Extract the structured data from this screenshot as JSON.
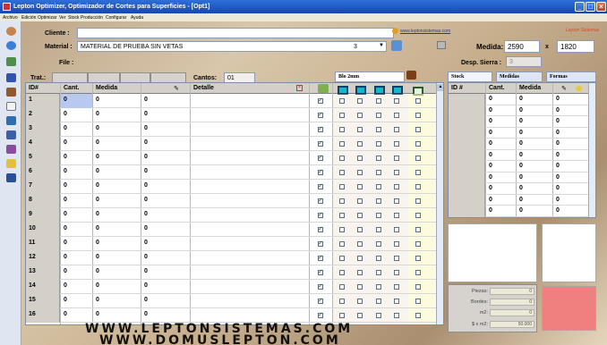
{
  "window": {
    "title": "Lepton Optimizer, Optimizador de Cortes para Superficies - [Opt1]",
    "controls": {
      "minimize": "_",
      "restore": "□",
      "close": "×"
    }
  },
  "menu": [
    "Archivo",
    "Edición",
    "Optimizar",
    "Ver",
    "Stock",
    "Producción",
    "Configurar",
    "Ayuda"
  ],
  "header": {
    "cliente_label": "Cliente :",
    "cliente_value": "",
    "material_label": "Material :",
    "material_value": "MATERIAL DE PRUEBA SIN VETAS",
    "material_qty": "3",
    "file_label": "File :",
    "file_value": "",
    "link": "www.leptonsistemas.com",
    "brand": "Lepton Sistemas",
    "medida_label": "Medida:",
    "medida_w": "2590",
    "medida_x": "x",
    "medida_h": "1820",
    "desp_label": "Desp. Sierra :",
    "desp_value": "3"
  },
  "toolbar2": {
    "trat_label": "Trat.:",
    "cantos_label": "Cantos:",
    "cantos_value": "01",
    "canto_name": "Blo 2mm"
  },
  "grid": {
    "headers": {
      "id": "ID#",
      "cant": "Cant.",
      "medida": "Medida",
      "detalle": "Detalle"
    },
    "rows": [
      {
        "id": "1",
        "cant": "0",
        "m1": "0",
        "m2": "0",
        "checked": true
      },
      {
        "id": "2",
        "cant": "0",
        "m1": "0",
        "m2": "0",
        "checked": true
      },
      {
        "id": "3",
        "cant": "0",
        "m1": "0",
        "m2": "0",
        "checked": true
      },
      {
        "id": "4",
        "cant": "0",
        "m1": "0",
        "m2": "0",
        "checked": true
      },
      {
        "id": "5",
        "cant": "0",
        "m1": "0",
        "m2": "0",
        "checked": true
      },
      {
        "id": "6",
        "cant": "0",
        "m1": "0",
        "m2": "0",
        "checked": true
      },
      {
        "id": "7",
        "cant": "0",
        "m1": "0",
        "m2": "0",
        "checked": true
      },
      {
        "id": "8",
        "cant": "0",
        "m1": "0",
        "m2": "0",
        "checked": true
      },
      {
        "id": "9",
        "cant": "0",
        "m1": "0",
        "m2": "0",
        "checked": true
      },
      {
        "id": "10",
        "cant": "0",
        "m1": "0",
        "m2": "0",
        "checked": true
      },
      {
        "id": "11",
        "cant": "0",
        "m1": "0",
        "m2": "0",
        "checked": true
      },
      {
        "id": "12",
        "cant": "0",
        "m1": "0",
        "m2": "0",
        "checked": true
      },
      {
        "id": "13",
        "cant": "0",
        "m1": "0",
        "m2": "0",
        "checked": true
      },
      {
        "id": "14",
        "cant": "0",
        "m1": "0",
        "m2": "0",
        "checked": true
      },
      {
        "id": "15",
        "cant": "0",
        "m1": "0",
        "m2": "0",
        "checked": true
      },
      {
        "id": "16",
        "cant": "0",
        "m1": "0",
        "m2": "0",
        "checked": true
      }
    ]
  },
  "stock": {
    "tabs": [
      "Stock",
      "Medidas",
      "Formas"
    ],
    "headers": {
      "id": "ID #",
      "cant": "Cant.",
      "medida": "Medida"
    },
    "rows": [
      {
        "cant": "0",
        "m1": "0",
        "m2": "0"
      },
      {
        "cant": "0",
        "m1": "0",
        "m2": "0"
      },
      {
        "cant": "0",
        "m1": "0",
        "m2": "0"
      },
      {
        "cant": "0",
        "m1": "0",
        "m2": "0"
      },
      {
        "cant": "0",
        "m1": "0",
        "m2": "0"
      },
      {
        "cant": "0",
        "m1": "0",
        "m2": "0"
      },
      {
        "cant": "0",
        "m1": "0",
        "m2": "0"
      },
      {
        "cant": "0",
        "m1": "0",
        "m2": "0"
      },
      {
        "cant": "0",
        "m1": "0",
        "m2": "0"
      },
      {
        "cant": "0",
        "m1": "0",
        "m2": "0"
      },
      {
        "cant": "0",
        "m1": "0",
        "m2": "0"
      }
    ]
  },
  "totals": {
    "piezas_label": "Piezas:",
    "piezas_value": "0",
    "bordes_label": "Bordes:",
    "bordes_value": "0",
    "m2_label": "m2:",
    "m2_value": "0",
    "sxm2_label": "$ x m2:",
    "sxm2_value": "50.000"
  },
  "watermark": [
    "WWW.LEPTONSISTEMAS.COM",
    "WWW.DOMUSLEPTON.COM"
  ],
  "colors": {
    "title_bar": "#1a52c0",
    "edge_box": "#11b9c9",
    "preview_red": "#f08080"
  }
}
